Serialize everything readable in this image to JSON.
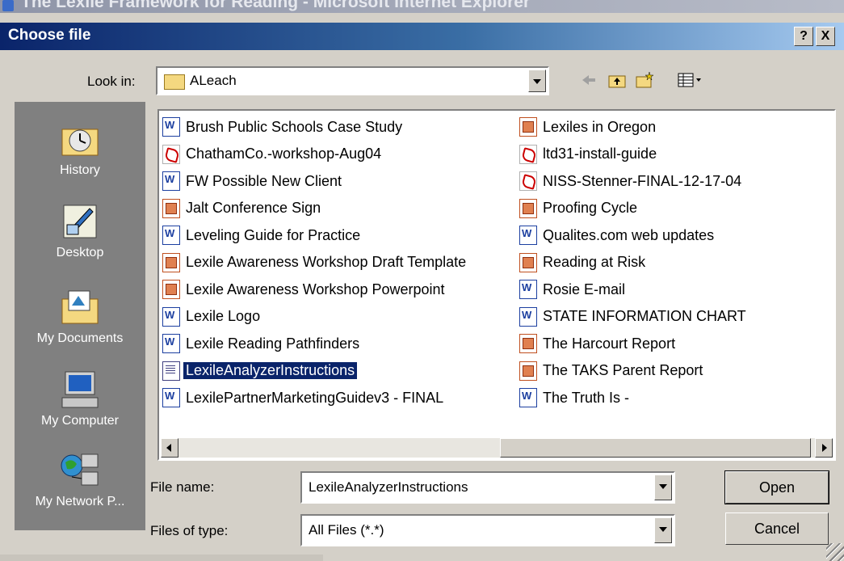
{
  "browser": {
    "title": "The Lexile Framework for Reading - Microsoft Internet Explorer"
  },
  "dialog": {
    "title": "Choose file",
    "help_label": "?",
    "close_label": "X"
  },
  "lookin": {
    "label": "Look in:",
    "value": "ALeach"
  },
  "places": [
    {
      "label": "History"
    },
    {
      "label": "Desktop"
    },
    {
      "label": "My Documents"
    },
    {
      "label": "My Computer"
    },
    {
      "label": "My Network P..."
    }
  ],
  "files": [
    {
      "name": "Brush Public Schools Case Study",
      "icon": "word-doc-icon"
    },
    {
      "name": "ChathamCo.-workshop-Aug04",
      "icon": "pdf-icon"
    },
    {
      "name": "FW Possible New Client",
      "icon": "word-doc-icon"
    },
    {
      "name": "Jalt Conference Sign",
      "icon": "powerpoint-icon"
    },
    {
      "name": "Leveling Guide for Practice",
      "icon": "word-doc-icon"
    },
    {
      "name": "Lexile Awareness Workshop Draft Template",
      "icon": "powerpoint-icon"
    },
    {
      "name": "Lexile Awareness Workshop Powerpoint",
      "icon": "powerpoint-icon"
    },
    {
      "name": "Lexile Logo",
      "icon": "word-doc-icon"
    },
    {
      "name": "Lexile Reading Pathfinders",
      "icon": "word-doc-icon"
    },
    {
      "name": "LexileAnalyzerInstructions",
      "icon": "text-doc-icon",
      "selected": true
    },
    {
      "name": "LexilePartnerMarketingGuidev3 - FINAL",
      "icon": "word-doc-icon"
    },
    {
      "name": "Lexiles in Oregon",
      "icon": "powerpoint-icon"
    },
    {
      "name": "ltd31-install-guide",
      "icon": "pdf-icon"
    },
    {
      "name": "NISS-Stenner-FINAL-12-17-04",
      "icon": "pdf-icon"
    },
    {
      "name": "Proofing Cycle",
      "icon": "powerpoint-icon"
    },
    {
      "name": "Qualites.com web updates",
      "icon": "word-doc-icon"
    },
    {
      "name": "Reading at Risk",
      "icon": "powerpoint-icon"
    },
    {
      "name": "Rosie E-mail",
      "icon": "word-doc-icon"
    },
    {
      "name": "STATE  INFORMATION  CHART",
      "icon": "word-doc-icon"
    },
    {
      "name": "The Harcourt Report",
      "icon": "powerpoint-icon"
    },
    {
      "name": "The TAKS Parent Report",
      "icon": "powerpoint-icon"
    },
    {
      "name": "The Truth Is -",
      "icon": "word-doc-icon"
    }
  ],
  "filename": {
    "label": "File name:",
    "value": "LexileAnalyzerInstructions"
  },
  "filetype": {
    "label": "Files of type:",
    "value": "All Files (*.*)"
  },
  "buttons": {
    "open": "Open",
    "cancel": "Cancel"
  }
}
